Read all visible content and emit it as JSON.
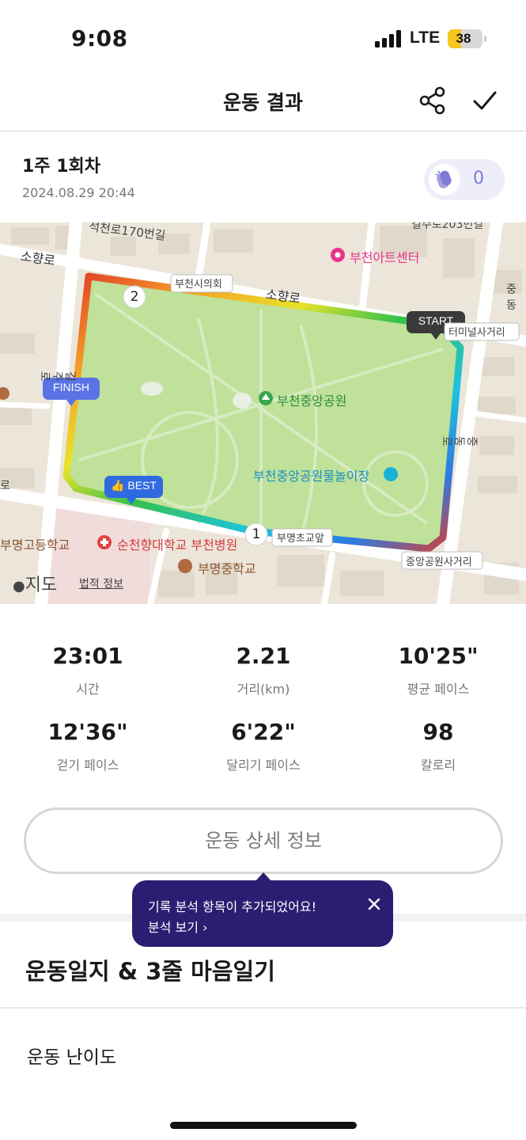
{
  "status_bar": {
    "time": "9:08",
    "network": "LTE",
    "battery_level": 38,
    "battery_text": "38"
  },
  "header": {
    "title": "운동 결과",
    "share_icon": "share-icon",
    "done_icon": "check-icon"
  },
  "session": {
    "title": "1주 1회차",
    "date": "2024.08.29 20:44",
    "clap_count": "0",
    "clap_icon": "clap-icon"
  },
  "map": {
    "markers": {
      "start": "START",
      "finish": "FINISH",
      "best": "BEST",
      "km1": "1",
      "km2": "2"
    },
    "labels": {
      "road_170": "석천로170번길",
      "sohyang_left": "소향로",
      "sohyang_center": "소향로",
      "city_hall": "부천시의회",
      "art_center": "부천아트센터",
      "terminal_intersection": "터미널사거리",
      "park": "부천중앙공원",
      "water_park": "부천중앙공원물놀이장",
      "elementary": "부명초교앞",
      "park_intersection": "중앙공원사거리",
      "hospital": "순천향대학교 부천병원",
      "middle_school": "부명중학교",
      "high_school": "부명고등학교",
      "road_right_top": "중동",
      "road_right_vertical": "중동로",
      "road_left_vertical": "길주로",
      "road_top_right": "길주로203번길",
      "road_left_edge": "로"
    },
    "attribution": "지도",
    "legal": "법적 정보",
    "colors": {
      "park": "#bfe19a",
      "roads": "#ffffff",
      "block": "#e6dfd1",
      "building": "#ddd5c6",
      "pin_pink": "#e8358a",
      "pin_green": "#39a74b",
      "pin_red": "#e04343",
      "pin_brown": "#b06a40",
      "marker_dark": "#3a3a3a",
      "marker_finish": "#5a74e6",
      "marker_best": "#2f6ae0"
    }
  },
  "stats": [
    {
      "value": "23:01",
      "label": "시간"
    },
    {
      "value": "2.21",
      "label": "거리(km)"
    },
    {
      "value": "10'25\"",
      "label": "평균 페이스"
    },
    {
      "value": "12'36\"",
      "label": "걷기 페이스"
    },
    {
      "value": "6'22\"",
      "label": "달리기 페이스"
    },
    {
      "value": "98",
      "label": "칼로리"
    }
  ],
  "detail_button": "운동 상세 정보",
  "tooltip": {
    "message": "기록 분석 항목이 추가되었어요!",
    "link": "분석 보기 ›",
    "close_icon": "close-icon",
    "color": "#2d1d72"
  },
  "journal": {
    "title": "운동일지 & 3줄 마음일기",
    "difficulty_title": "운동 난이도"
  }
}
